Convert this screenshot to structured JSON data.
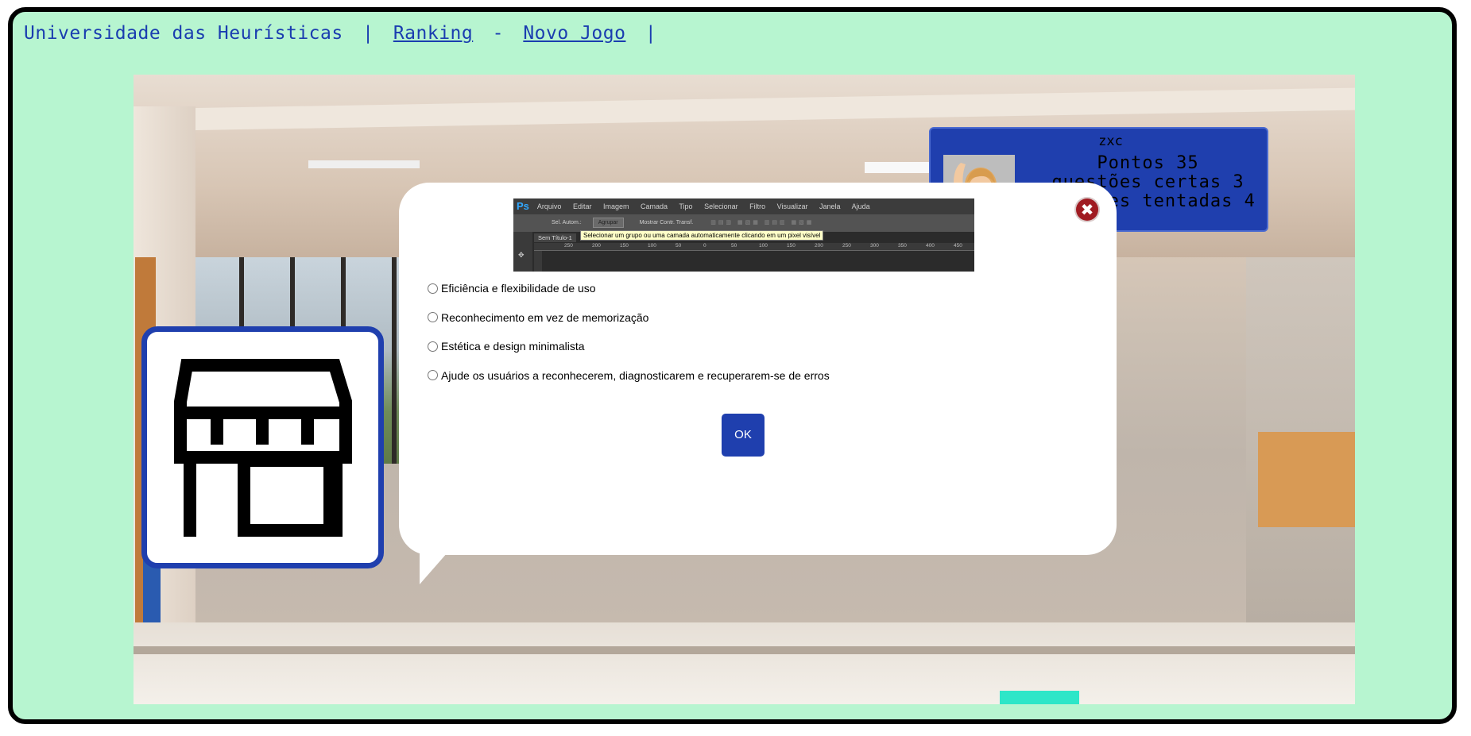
{
  "header": {
    "site_name": "Universidade das Heurísticas",
    "divider1": "|",
    "ranking_link": "Ranking",
    "dash": "-",
    "new_game_link": "Novo Jogo",
    "divider2": "|"
  },
  "player": {
    "name": "zxc",
    "points_label": "Pontos 35",
    "correct_label": "questões certas 3",
    "attempted_label": "questões tentadas 4",
    "avatar_icon": "person-raising-hand-icon"
  },
  "question": {
    "screenshot": {
      "app_logo": "Ps",
      "menu": [
        "Arquivo",
        "Editar",
        "Imagem",
        "Camada",
        "Tipo",
        "Selecionar",
        "Filtro",
        "Visualizar",
        "Janela",
        "Ajuda"
      ],
      "toolbar_auto_select": "Sel. Autom.:",
      "toolbar_group": "Agrupar",
      "toolbar_show_transform": "Mostrar Contr. Transf.",
      "tooltip": "Selecionar um grupo ou uma camada automaticamente clicando em um pixel visível",
      "doc_tab": "Sem Título-1",
      "ruler_ticks": [
        "250",
        "200",
        "150",
        "100",
        "50",
        "0",
        "50",
        "100",
        "150",
        "200",
        "250",
        "300",
        "350",
        "400",
        "450"
      ]
    },
    "options": [
      "Eficiência e flexibilidade de uso",
      "Reconhecimento em vez de memorização",
      "Estética e design minimalista",
      "Ajude os usuários a reconhecerem, diagnosticarem e recuperarem-se de erros"
    ],
    "ok_label": "OK",
    "close_icon": "close-icon"
  },
  "location_icon": "store-icon",
  "colors": {
    "background": "#b7f5d0",
    "primary_blue": "#1f3fae",
    "close_red": "#a01b22"
  }
}
